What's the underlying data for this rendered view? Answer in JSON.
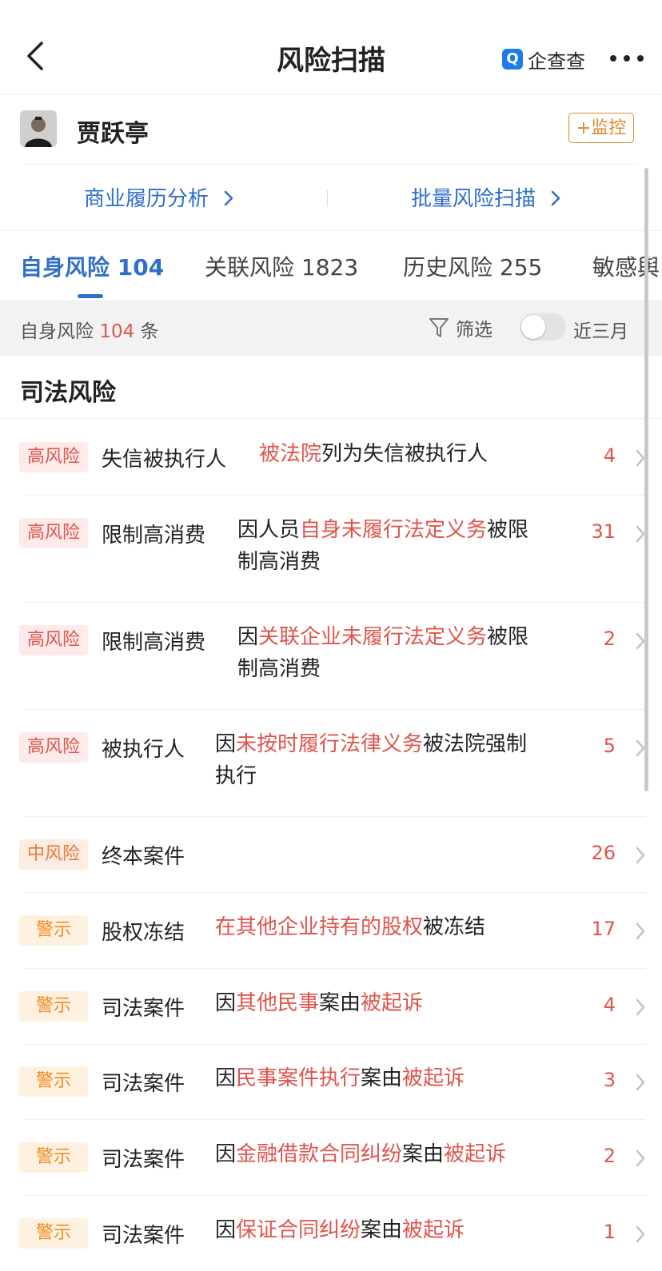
{
  "nav": {
    "title": "风险扫描",
    "brand_logo_char": "Q",
    "brand_name": "企查查"
  },
  "person": {
    "name": "贾跃亭",
    "monitor_label": "+监控"
  },
  "quick_links": [
    {
      "label": "商业履历分析"
    },
    {
      "label": "批量风险扫描"
    }
  ],
  "tabs": [
    {
      "label": "自身风险",
      "count": "104"
    },
    {
      "label": "关联风险",
      "count": "1823"
    },
    {
      "label": "历史风险",
      "count": "255"
    },
    {
      "label": "敏感舆",
      "count": ""
    }
  ],
  "summary": {
    "prefix": "自身风险",
    "count": "104",
    "suffix": "条",
    "filter_label": "筛选",
    "toggle_label": "近三月"
  },
  "section": {
    "title": "司法风险"
  },
  "items": [
    {
      "badge": "高风险",
      "type": "失信被执行人",
      "desc": [
        [
          "被法院",
          1
        ],
        [
          "列为失信被执行人",
          0
        ]
      ],
      "count": "4"
    },
    {
      "badge": "高风险",
      "type": "限制高消费",
      "desc": [
        [
          "因人员",
          0
        ],
        [
          "自身未履行法定义务",
          1
        ],
        [
          "被限制高消费",
          0
        ]
      ],
      "count": "31"
    },
    {
      "badge": "高风险",
      "type": "限制高消费",
      "desc": [
        [
          "因",
          0
        ],
        [
          "关联企业未履行法定义务",
          1
        ],
        [
          "被限制高消费",
          0
        ]
      ],
      "count": "2"
    },
    {
      "badge": "高风险",
      "type": "被执行人",
      "desc": [
        [
          "因",
          0
        ],
        [
          "未按时履行法律义务",
          1
        ],
        [
          "被法院强制执行",
          0
        ]
      ],
      "count": "5"
    },
    {
      "badge": "中风险",
      "type": "终本案件",
      "desc": [],
      "count": "26"
    },
    {
      "badge": "警示",
      "type": "股权冻结",
      "desc": [
        [
          "在其他企业持有的股权",
          1
        ],
        [
          "被冻结",
          0
        ]
      ],
      "count": "17"
    },
    {
      "badge": "警示",
      "type": "司法案件",
      "desc": [
        [
          "因",
          0
        ],
        [
          "其他民事",
          1
        ],
        [
          "案由",
          0
        ],
        [
          "被起诉",
          1
        ]
      ],
      "count": "4"
    },
    {
      "badge": "警示",
      "type": "司法案件",
      "desc": [
        [
          "因",
          0
        ],
        [
          "民事案件执行",
          1
        ],
        [
          "案由",
          0
        ],
        [
          "被起诉",
          1
        ]
      ],
      "count": "3"
    },
    {
      "badge": "警示",
      "type": "司法案件",
      "desc": [
        [
          "因",
          0
        ],
        [
          "金融借款合同纠纷",
          1
        ],
        [
          "案由",
          0
        ],
        [
          "被起诉",
          1
        ]
      ],
      "count": "2"
    },
    {
      "badge": "警示",
      "type": "司法案件",
      "desc": [
        [
          "因",
          0
        ],
        [
          "保证合同纠纷",
          1
        ],
        [
          "案由",
          0
        ],
        [
          "被起诉",
          1
        ]
      ],
      "count": "1"
    }
  ],
  "colors": {
    "accent": "#2f6fc9",
    "danger": "#e0544c",
    "warn": "#f08a24",
    "monitor": "#e08a2c"
  }
}
